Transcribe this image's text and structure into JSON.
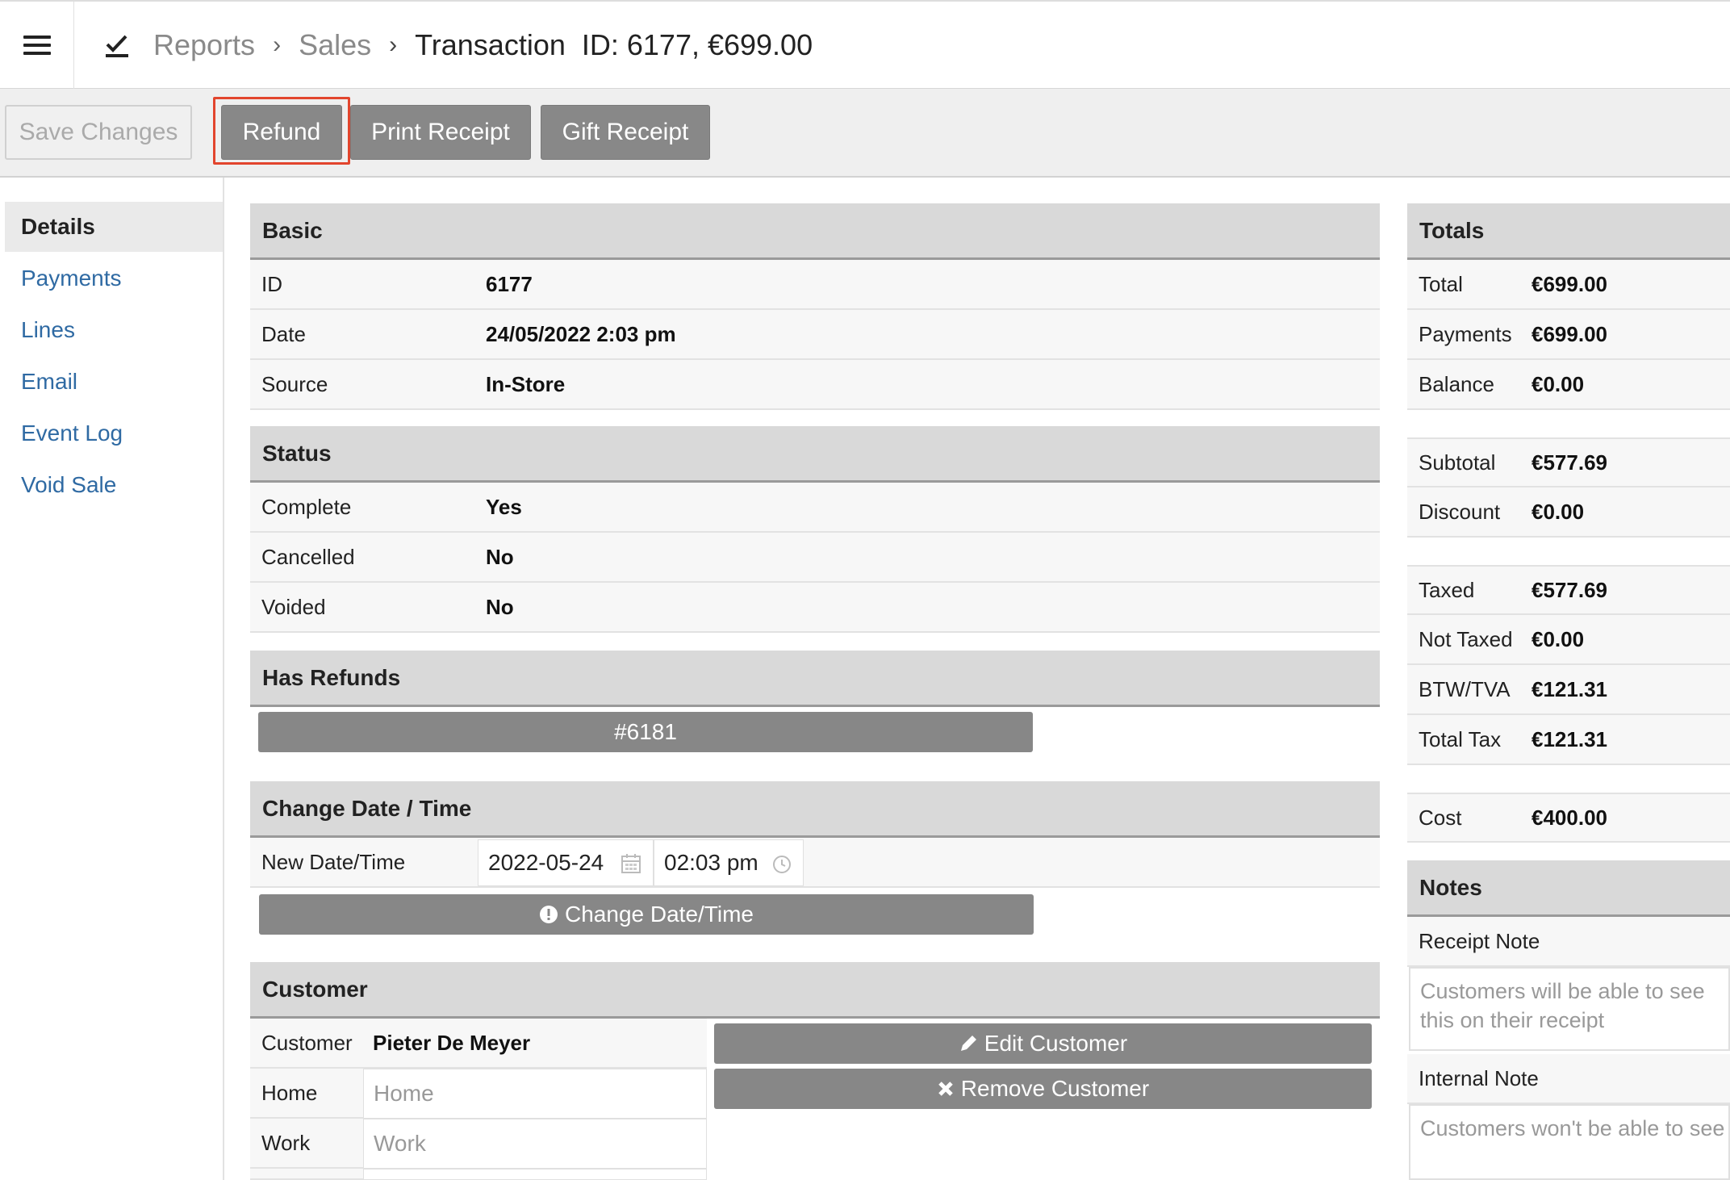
{
  "header": {
    "menu_icon": "hamburger-menu-icon",
    "reports_icon": "chart-check-icon",
    "breadcrumbs": [
      "Reports",
      "Sales"
    ],
    "current": "Transaction  ID: 6177, €699.00"
  },
  "toolbar": {
    "save_label": "Save Changes",
    "refund_label": "Refund",
    "print_label": "Print Receipt",
    "gift_label": "Gift Receipt"
  },
  "sidebar": {
    "items": [
      {
        "label": "Details"
      },
      {
        "label": "Payments"
      },
      {
        "label": "Lines"
      },
      {
        "label": "Email"
      },
      {
        "label": "Event Log"
      },
      {
        "label": "Void Sale"
      }
    ]
  },
  "basic": {
    "title": "Basic",
    "rows": [
      {
        "label": "ID",
        "value": "6177"
      },
      {
        "label": "Date",
        "value": "24/05/2022 2:03 pm"
      },
      {
        "label": "Source",
        "value": "In-Store"
      }
    ]
  },
  "status": {
    "title": "Status",
    "rows": [
      {
        "label": "Complete",
        "value": "Yes"
      },
      {
        "label": "Cancelled",
        "value": "No"
      },
      {
        "label": "Voided",
        "value": "No"
      }
    ]
  },
  "refunds": {
    "title": "Has Refunds",
    "refund_link": "#6181"
  },
  "change_date": {
    "title": "Change Date / Time",
    "label": "New Date/Time",
    "date_value": "2022-05-24",
    "time_value": "02:03 pm",
    "button_label": "Change Date/Time"
  },
  "customer": {
    "title": "Customer",
    "customer_label": "Customer",
    "customer_name": "Pieter De Meyer",
    "home_label": "Home",
    "home_placeholder": "Home",
    "work_label": "Work",
    "work_placeholder": "Work",
    "edit_label": "Edit Customer",
    "remove_label": "Remove Customer"
  },
  "totals": {
    "title": "Totals",
    "group1": [
      {
        "label": "Total",
        "value": "€699.00"
      },
      {
        "label": "Payments",
        "value": "€699.00"
      },
      {
        "label": "Balance",
        "value": "€0.00"
      }
    ],
    "group2": [
      {
        "label": "Subtotal",
        "value": "€577.69"
      },
      {
        "label": "Discount",
        "value": "€0.00"
      }
    ],
    "group3": [
      {
        "label": "Taxed",
        "value": "€577.69"
      },
      {
        "label": "Not Taxed",
        "value": "€0.00"
      },
      {
        "label": "BTW/TVA",
        "value": "€121.31"
      },
      {
        "label": "Total Tax",
        "value": "€121.31"
      }
    ],
    "group4": [
      {
        "label": "Cost",
        "value": "€400.00"
      }
    ]
  },
  "notes": {
    "title": "Notes",
    "receipt_label": "Receipt Note",
    "receipt_placeholder": "Customers will be able to see this on their receipt",
    "internal_label": "Internal Note",
    "internal_placeholder": "Customers won't be able to see this"
  },
  "colors": {
    "accent_link": "#2f6aa3",
    "button_gray": "#888888",
    "highlight_red": "#e2452d"
  }
}
